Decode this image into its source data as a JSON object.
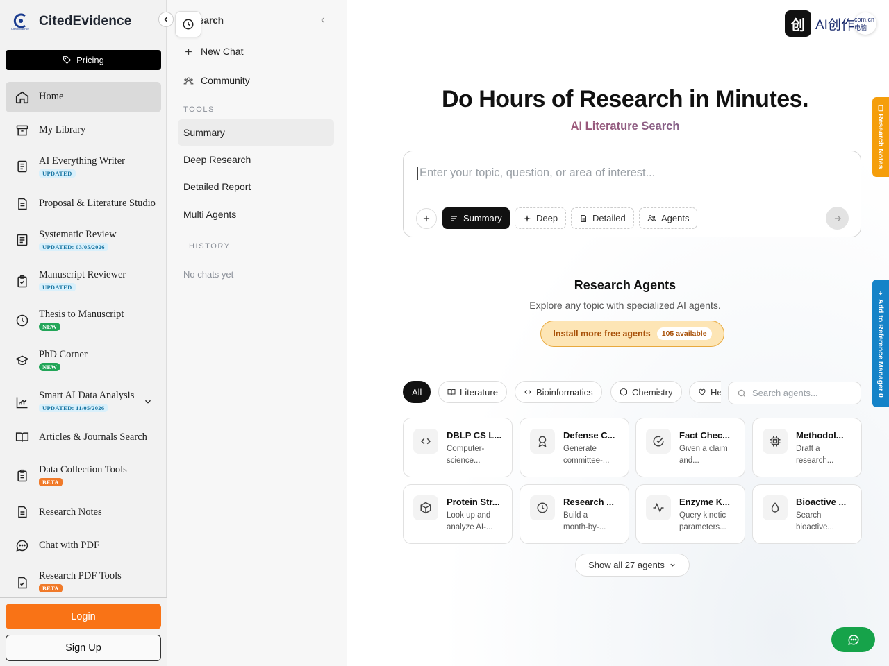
{
  "brand": {
    "name": "CitedEvidence",
    "logo_caption": "CitedEvidence"
  },
  "pricing": {
    "label": "Pricing"
  },
  "nav": [
    {
      "label": "Home",
      "icon": "home-icon",
      "active": true
    },
    {
      "label": "My Library",
      "icon": "archive-icon"
    },
    {
      "label": "AI Everything Writer",
      "icon": "document-icon",
      "badge": "UPDATED",
      "badge_style": "blue"
    },
    {
      "label": "Proposal & Literature Studio",
      "icon": "file-text-icon"
    },
    {
      "label": "Systematic Review",
      "icon": "list-icon",
      "badge": "UPDATED: 03/05/2026",
      "badge_style": "blue"
    },
    {
      "label": "Manuscript Reviewer",
      "icon": "clipboard-check-icon",
      "badge": "UPDATED",
      "badge_style": "blue"
    },
    {
      "label": "Thesis to Manuscript",
      "icon": "clock-icon",
      "badge": "NEW",
      "badge_style": "green"
    },
    {
      "label": "PhD Corner",
      "icon": "graduation-cap-icon",
      "badge": "NEW",
      "badge_style": "green"
    },
    {
      "label": "Smart AI Data Analysis",
      "icon": "chart-icon",
      "badge": "UPDATED: 11/05/2026",
      "badge_style": "blue",
      "expandable": true
    },
    {
      "label": "Articles & Journals Search",
      "icon": "book-open-icon"
    },
    {
      "label": "Data Collection Tools",
      "icon": "clipboard-list-icon",
      "badge": "BETA",
      "badge_style": "orange"
    },
    {
      "label": "Research Notes",
      "icon": "note-icon"
    },
    {
      "label": "Chat with PDF",
      "icon": "chat-bubble-icon"
    },
    {
      "label": "Research PDF Tools",
      "icon": "file-check-icon",
      "badge": "BETA",
      "badge_style": "orange"
    }
  ],
  "auth": {
    "login": "Login",
    "signup": "Sign Up"
  },
  "panel": {
    "title": "earch",
    "new_chat": "New Chat",
    "community": "Community",
    "tools_heading": "TOOLS",
    "tools": [
      "Summary",
      "Deep Research",
      "Detailed Report",
      "Multi Agents"
    ],
    "history_heading": "HISTORY",
    "no_chats": "No chats yet"
  },
  "header": {
    "ai_logo_char": "创",
    "ai_logo_text": "AI创作",
    "avatar_text": "com.cn\n电脑"
  },
  "hero": {
    "title": "Do Hours of Research in Minutes.",
    "subtitle": "AI Literature Search"
  },
  "search": {
    "placeholder": "Enter your topic, question, or area of interest...",
    "modes": [
      {
        "label": "Summary",
        "icon": "lines-icon",
        "selected": true
      },
      {
        "label": "Deep",
        "icon": "sparkle-icon"
      },
      {
        "label": "Detailed",
        "icon": "document-icon"
      },
      {
        "label": "Agents",
        "icon": "users-icon"
      }
    ]
  },
  "agents": {
    "title": "Research Agents",
    "subtitle": "Explore any topic with specialized AI agents.",
    "install_label": "Install more free agents",
    "install_count": "105 available",
    "categories": [
      {
        "label": "All",
        "selected": true
      },
      {
        "label": "Literature",
        "icon": "book-icon"
      },
      {
        "label": "Bioinformatics",
        "icon": "code-icon"
      },
      {
        "label": "Chemistry",
        "icon": "hexagon-icon"
      },
      {
        "label": "He",
        "icon": "heart-icon"
      }
    ],
    "search_placeholder": "Search agents...",
    "cards": [
      {
        "title": "DBLP CS L...",
        "desc": "Computer-science...",
        "icon": "code-icon"
      },
      {
        "title": "Defense C...",
        "desc": "Generate committee-...",
        "icon": "award-icon"
      },
      {
        "title": "Fact Chec...",
        "desc": "Given a claim and...",
        "icon": "check-circle-icon"
      },
      {
        "title": "Methodol...",
        "desc": "Draft a research...",
        "icon": "chip-icon"
      },
      {
        "title": "Protein Str...",
        "desc": "Look up and analyze AI-...",
        "icon": "box-icon"
      },
      {
        "title": "Research ...",
        "desc": "Build a month-by-...",
        "icon": "clock-icon"
      },
      {
        "title": "Enzyme K...",
        "desc": "Query kinetic parameters...",
        "icon": "activity-icon"
      },
      {
        "title": "Bioactive ...",
        "desc": "Search bioactive...",
        "icon": "droplet-icon"
      }
    ],
    "show_all": "Show all 27 agents"
  },
  "side_tabs": {
    "notes": "Research Notes",
    "reference": "Add to Reference Manager",
    "reference_count": "0"
  },
  "colors": {
    "accent": "#f97316",
    "install_bg": "#fde5b5",
    "notes_tab": "#f59e0b",
    "reference_tab": "#1583c8",
    "chat_fab": "#16a34a"
  }
}
